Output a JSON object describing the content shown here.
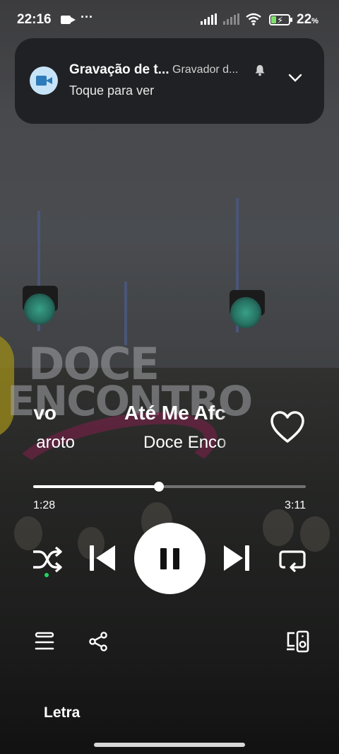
{
  "status_bar": {
    "time": "22:16",
    "battery_percent": "22",
    "battery_percent_sign": "%",
    "overflow_dots": "···"
  },
  "notification": {
    "title": "Gravação de t...",
    "app_name": "Gravador d...",
    "text": "Toque para ver"
  },
  "background_sign": {
    "line1": "DOCE",
    "line2": "ENCONTRO"
  },
  "player": {
    "title_prev_fragment": "vo",
    "title": "Até Me Afc",
    "artist_prev_fragment": "aroto",
    "artist": "Doce Enco",
    "liked": false,
    "time_current": "1:28",
    "time_total": "3:11",
    "progress_fraction": 0.46,
    "shuffle_active": true,
    "is_playing": true,
    "lyrics_label": "Letra"
  },
  "colors": {
    "accent_green": "#1ed760",
    "notification_bg": "#202124",
    "notification_icon_bg": "#c7e3f8"
  }
}
